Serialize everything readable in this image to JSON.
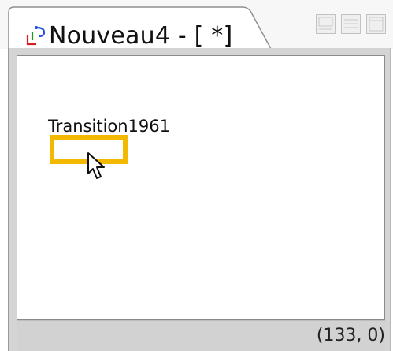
{
  "tab": {
    "title": "Nouveau4 - [ *]",
    "icon": "petri-net-icon"
  },
  "window_controls": [
    "minimize-icon",
    "restore-icon",
    "maximize-icon"
  ],
  "canvas": {
    "transition": {
      "label": "Transition1961",
      "border_color": "#f3b800"
    }
  },
  "status_bar": {
    "coordinates": "(133, 0)"
  }
}
